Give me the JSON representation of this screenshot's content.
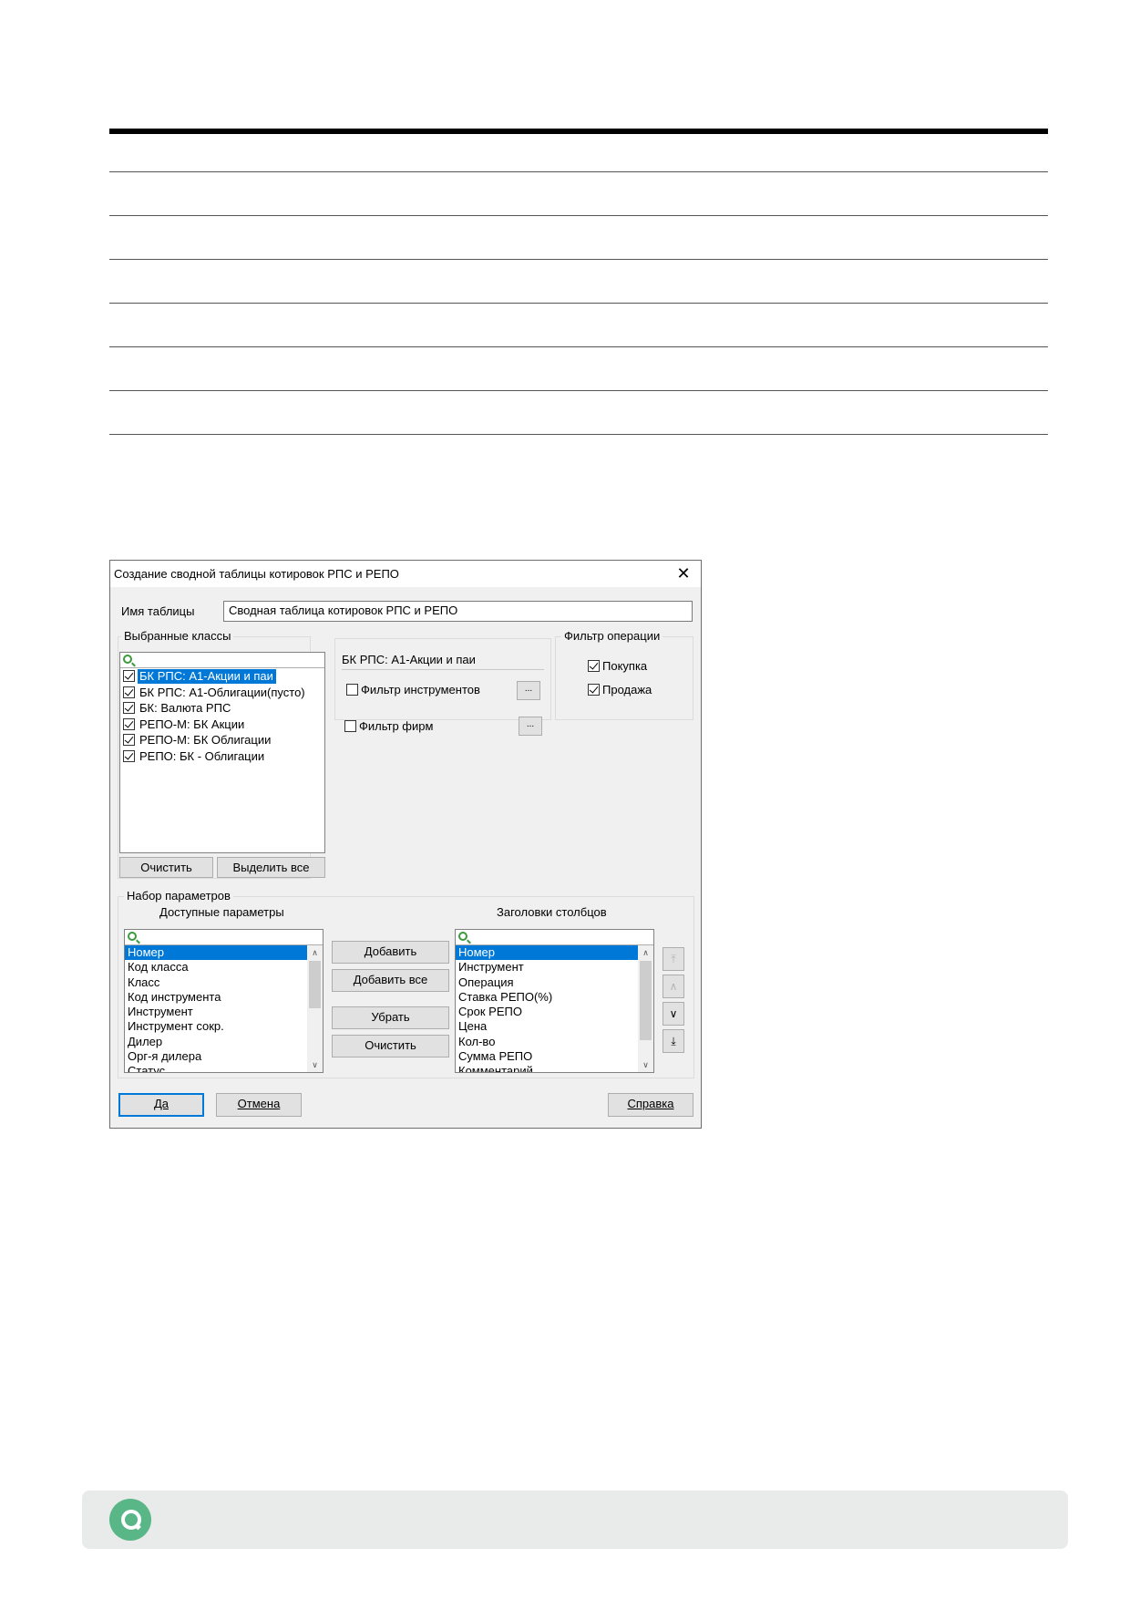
{
  "dialog": {
    "title": "Создание сводной таблицы котировок РПС и РЕПО",
    "table_name_label": "Имя таблицы",
    "table_name_value": "Сводная таблица котировок РПС и РЕПО",
    "classes_group_title": "Выбранные классы",
    "classes": [
      {
        "label": "БК РПС: А1-Акции и паи",
        "checked": true,
        "selected": true
      },
      {
        "label": "БК РПС: А1-Облигации(пусто)",
        "checked": true,
        "selected": false
      },
      {
        "label": "БК: Валюта РПС",
        "checked": true,
        "selected": false
      },
      {
        "label": "РЕПО-М: БК Акции",
        "checked": true,
        "selected": false
      },
      {
        "label": "РЕПО-М: БК Облигации",
        "checked": true,
        "selected": false
      },
      {
        "label": "РЕПО: БК - Облигации",
        "checked": true,
        "selected": false
      }
    ],
    "clear_classes_label": "Очистить",
    "select_all_label": "Выделить все",
    "class_detail": "БК РПС: А1-Акции и паи",
    "instrument_filter_label": "Фильтр инструментов",
    "firm_filter_label": "Фильтр фирм",
    "ellipsis_label": "...",
    "operation_filter_title": "Фильтр операции",
    "buy_label": "Покупка",
    "sell_label": "Продажа",
    "params_group_title": "Набор параметров",
    "available_params_title": "Доступные параметры",
    "available_params": [
      "Номер",
      "Код класса",
      "Класс",
      "Код инструмента",
      "Инструмент",
      "Инструмент сокр.",
      "Дилер",
      "Орг-я дилера",
      "Статус"
    ],
    "column_headers_title": "Заголовки столбцов",
    "column_headers": [
      "Номер",
      "Инструмент",
      "Операция",
      "Ставка РЕПО(%)",
      "Срок РЕПО",
      "Цена",
      "Кол-во",
      "Сумма РЕПО",
      "Комментарий"
    ],
    "add_label": "Добавить",
    "add_all_label": "Добавить все",
    "remove_label": "Убрать",
    "clear_params_label": "Очистить",
    "ok_label": "Да",
    "cancel_label": "Отмена",
    "help_label": "Справка"
  }
}
